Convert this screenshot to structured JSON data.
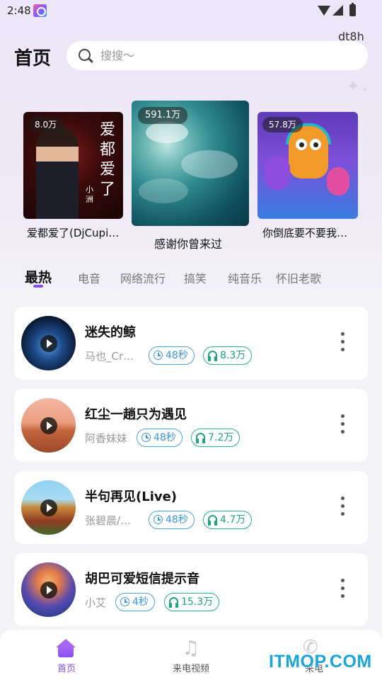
{
  "status_bar": {
    "time": "2:48"
  },
  "header": {
    "title": "首页",
    "account": "dt8h",
    "search_placeholder": "搜搜～"
  },
  "featured": [
    {
      "badge": "8.0万",
      "title": "爱都爱了(DjCupid.Chino...",
      "cover_text": "爱都爱了",
      "cover_text_small": "小洲"
    },
    {
      "badge": "591.1万",
      "title": "感谢你曾来过"
    },
    {
      "badge": "57.8万",
      "title": "你倒底要不要我接..."
    }
  ],
  "tabs": [
    {
      "label": "最热",
      "active": true
    },
    {
      "label": "电音",
      "active": false
    },
    {
      "label": "网络流行",
      "active": false
    },
    {
      "label": "搞笑",
      "active": false
    },
    {
      "label": "纯音乐",
      "active": false
    },
    {
      "label": "怀旧老歌",
      "active": false
    }
  ],
  "songs": [
    {
      "title": "迷失的鲸",
      "artist": "马也_Crazy",
      "duration": "48秒",
      "plays": "8.3万"
    },
    {
      "title": "红尘一趟只为遇见",
      "artist": "阿香妹妹",
      "duration": "48秒",
      "plays": "7.2万"
    },
    {
      "title": "半句再见(Live)",
      "artist": "张碧晨/余…",
      "duration": "48秒",
      "plays": "4.7万"
    },
    {
      "title": "胡巴可爱短信提示音",
      "artist": "小艾",
      "duration": "4秒",
      "plays": "15.3万"
    }
  ],
  "bottom_nav": [
    {
      "label": "首页",
      "icon": "home-icon",
      "active": true
    },
    {
      "label": "来电视频",
      "icon": "music-note-icon",
      "active": false
    },
    {
      "label": "来电",
      "icon": "phone-icon",
      "active": false
    }
  ],
  "watermark": "ITMOP.COM",
  "colors": {
    "accent": "#8a4ff0",
    "duration_pill": "#3a97e0",
    "plays_pill": "#1ea57c",
    "watermark": "#1aa6dc"
  }
}
